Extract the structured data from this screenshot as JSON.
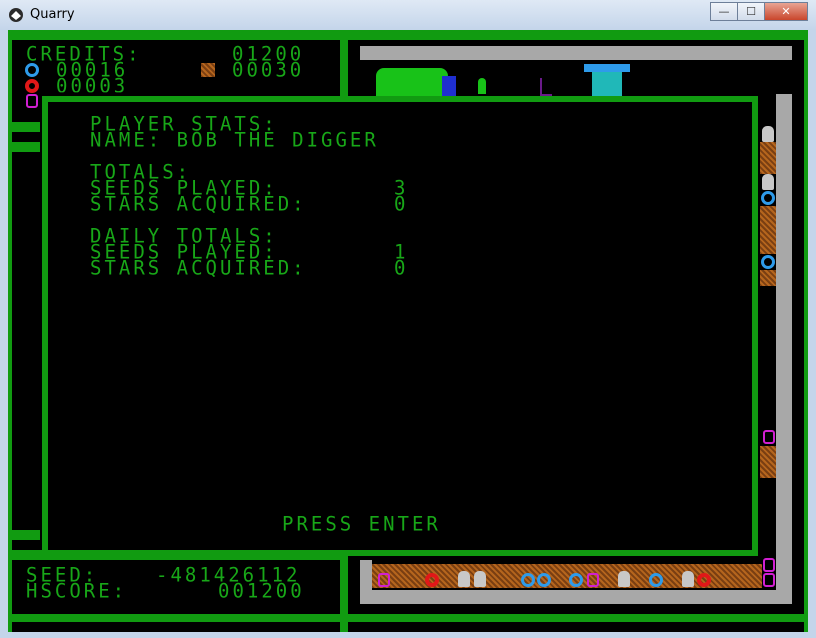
{
  "window": {
    "title": "Quarry",
    "minimize": "—",
    "maximize": "☐",
    "close": "✕"
  },
  "hud": {
    "credits_label": "CREDITS:",
    "credits_value": "01200",
    "blue_count": "00016",
    "dirt_count": "00030",
    "red_count": "00003",
    "seed_label": "SEED:",
    "seed_value": "-481426112",
    "hscore_label": "HSCORE:",
    "hscore_value": "001200"
  },
  "stats": {
    "heading": "PLAYER STATS:",
    "name_line": "NAME: BOB THE DIGGER",
    "totals_heading": "TOTALS:",
    "seeds_played_label": "SEEDS PLAYED:",
    "seeds_played_value": "3",
    "stars_acquired_label": "STARS ACQUIRED:",
    "stars_acquired_value": "0",
    "daily_heading": "DAILY TOTALS:",
    "daily_seeds_played_label": "SEEDS PLAYED:",
    "daily_seeds_played_value": "1",
    "daily_stars_acquired_label": "STARS ACQUIRED:",
    "daily_stars_acquired_value": "0",
    "prompt": "PRESS ENTER"
  },
  "colors": {
    "green": "#18a718",
    "blue": "#2e9bea",
    "red": "#e01818",
    "magenta": "#d11fd1"
  }
}
